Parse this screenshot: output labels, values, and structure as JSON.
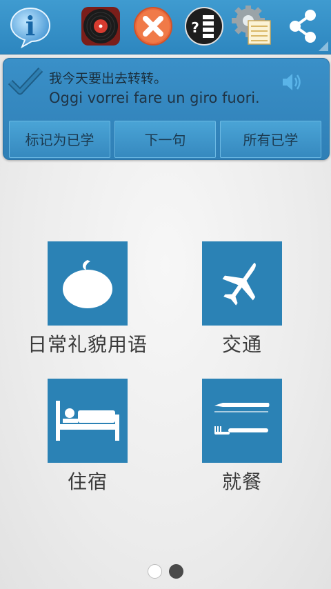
{
  "toolbar": {
    "icons": [
      "info-icon",
      "vinyl-record-icon",
      "close-icon",
      "quiz-icon",
      "settings-list-icon",
      "share-icon"
    ],
    "info_glyph": "i",
    "quiz_glyph": "?"
  },
  "sentence": {
    "chinese": "我今天要出去转转。",
    "italian": "Oggi vorrei fare un giro fuori."
  },
  "actions": {
    "mark_learned": "标记为已学",
    "next_sentence": "下一句",
    "all_learned": "所有已学"
  },
  "categories": [
    {
      "label": "日常礼貌用语",
      "icon": "speech-bubble-icon"
    },
    {
      "label": "交通",
      "icon": "airplane-icon"
    },
    {
      "label": "住宿",
      "icon": "bed-icon"
    },
    {
      "label": "就餐",
      "icon": "knife-fork-icon"
    }
  ],
  "pager": {
    "current_page": 2,
    "total_pages": 2
  },
  "colors": {
    "accent": "#2b82b5",
    "toolbar": "#3a94cb"
  }
}
